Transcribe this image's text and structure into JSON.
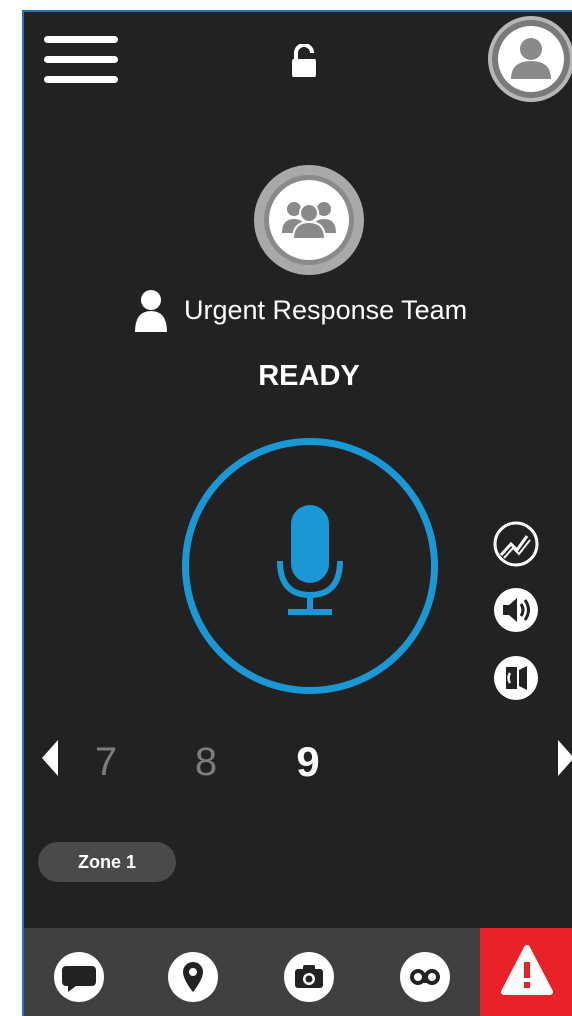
{
  "header": {
    "menu_icon": "hamburger-menu-icon",
    "lock_icon": "unlocked-padlock-icon",
    "profile_icon": "user-profile-icon"
  },
  "talkgroup": {
    "avatar_icon": "group-icon",
    "type_icon": "person-icon",
    "name": "Urgent Response Team"
  },
  "status": "READY",
  "ptt": {
    "icon": "microphone-icon",
    "color": "#1a98d5"
  },
  "side_controls": [
    {
      "name": "signal-quality-icon"
    },
    {
      "name": "speaker-volume-icon"
    },
    {
      "name": "earpiece-icon"
    }
  ],
  "channels": {
    "prev_icon": "left-arrow-icon",
    "next_icon": "right-arrow-icon",
    "items": [
      {
        "label": "7",
        "active": false
      },
      {
        "label": "8",
        "active": false
      },
      {
        "label": "9",
        "active": true
      }
    ]
  },
  "zone": {
    "label": "Zone 1"
  },
  "bottom_tabs": [
    {
      "icon": "chat-bubble-icon"
    },
    {
      "icon": "location-pin-icon"
    },
    {
      "icon": "camera-icon"
    },
    {
      "icon": "voicemail-icon"
    }
  ],
  "emergency": {
    "icon": "warning-triangle-icon",
    "color": "#e9222a"
  }
}
